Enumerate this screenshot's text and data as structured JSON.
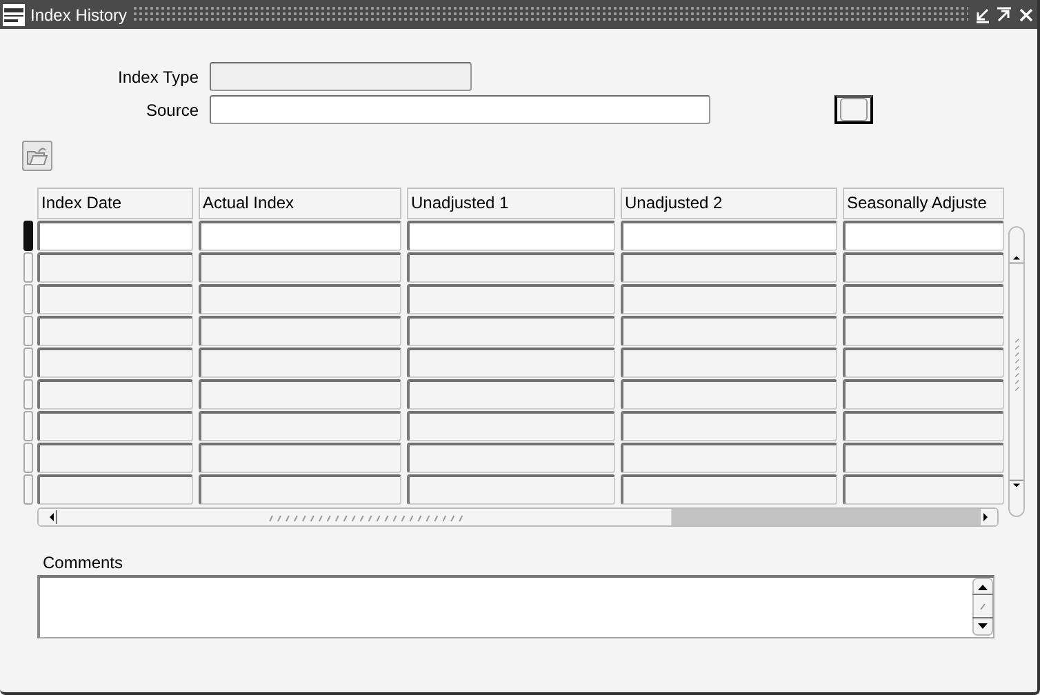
{
  "window": {
    "title": "Index History"
  },
  "fields": [
    {
      "label": "Index Type",
      "disabled": true
    },
    {
      "label": "Source",
      "disabled": false
    }
  ],
  "checkbox": {
    "checked": false
  },
  "table": {
    "columns": [
      "Index Date",
      "Actual Index",
      "Unadjusted 1",
      "Unadjusted 2",
      "Seasonally Adjuste"
    ],
    "rows": [
      {
        "selected": true
      },
      {
        "selected": false
      },
      {
        "selected": false
      },
      {
        "selected": false
      },
      {
        "selected": false
      },
      {
        "selected": false
      },
      {
        "selected": false
      },
      {
        "selected": false
      },
      {
        "selected": false
      }
    ]
  },
  "comments": {
    "label": "Comments"
  }
}
